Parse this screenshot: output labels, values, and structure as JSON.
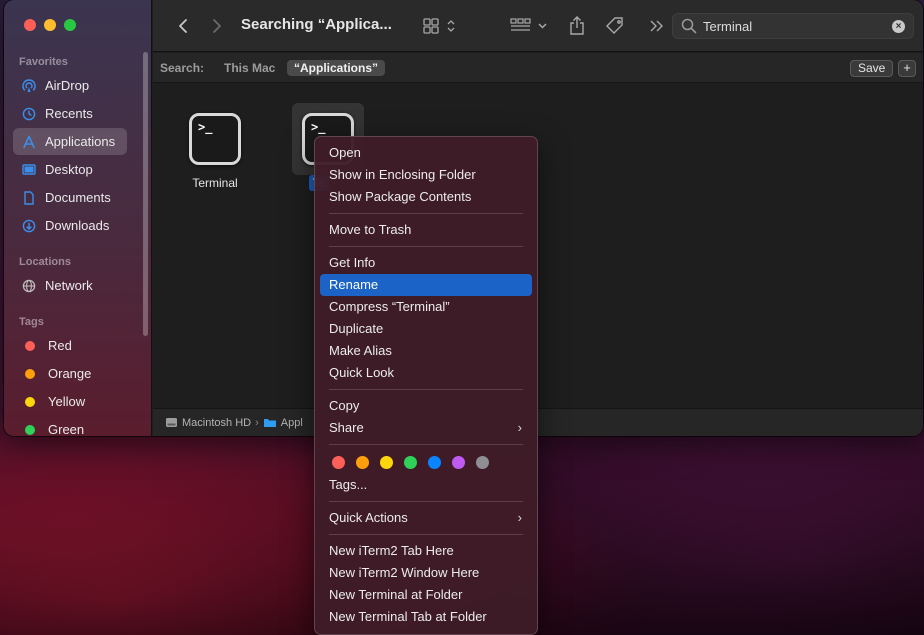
{
  "window": {
    "title": "Searching “Applica...",
    "search": {
      "value": "Terminal",
      "clear_label": "×"
    }
  },
  "sidebar": {
    "favorites_label": "Favorites",
    "favorites": [
      {
        "label": "AirDrop",
        "icon": "airdrop-icon"
      },
      {
        "label": "Recents",
        "icon": "clock-icon"
      },
      {
        "label": "Applications",
        "icon": "applications-icon",
        "selected": true
      },
      {
        "label": "Desktop",
        "icon": "desktop-icon"
      },
      {
        "label": "Documents",
        "icon": "document-icon"
      },
      {
        "label": "Downloads",
        "icon": "download-icon"
      }
    ],
    "locations_label": "Locations",
    "locations": [
      {
        "label": "Network",
        "icon": "globe-icon"
      }
    ],
    "tags_label": "Tags",
    "tags": [
      {
        "label": "Red",
        "color": "#fe5f57"
      },
      {
        "label": "Orange",
        "color": "#ff9f0a"
      },
      {
        "label": "Yellow",
        "color": "#ffd60a"
      },
      {
        "label": "Green",
        "color": "#30d158"
      }
    ]
  },
  "scopebar": {
    "label": "Search:",
    "options": [
      "This Mac",
      "“Applications”"
    ],
    "save_label": "Save",
    "plus_label": "+"
  },
  "files": [
    {
      "name": "Terminal",
      "icon_text": ">_"
    },
    {
      "name": "Te",
      "icon_text": ">_",
      "selected": true
    }
  ],
  "pathbar": {
    "items": [
      "Macintosh HD",
      "Appl"
    ],
    "separator": "›"
  },
  "context_menu": {
    "groups": [
      [
        "Open",
        "Show in Enclosing Folder",
        "Show Package Contents"
      ],
      [
        "Move to Trash"
      ],
      [
        "Get Info",
        "Rename",
        "Compress “Terminal”",
        "Duplicate",
        "Make Alias",
        "Quick Look"
      ],
      [
        "Copy",
        "Share"
      ],
      [
        "Tags..."
      ],
      [
        "Quick Actions"
      ],
      [
        "New iTerm2 Tab Here",
        "New iTerm2 Window Here",
        "New Terminal at Folder",
        "New Terminal Tab at Folder"
      ]
    ],
    "highlighted": "Rename",
    "tag_colors": [
      "#fe5f57",
      "#ff9f0a",
      "#ffd60a",
      "#30d158",
      "#0a84ff",
      "#bf5af2",
      "#8e8e93"
    ],
    "chevron": "›"
  }
}
